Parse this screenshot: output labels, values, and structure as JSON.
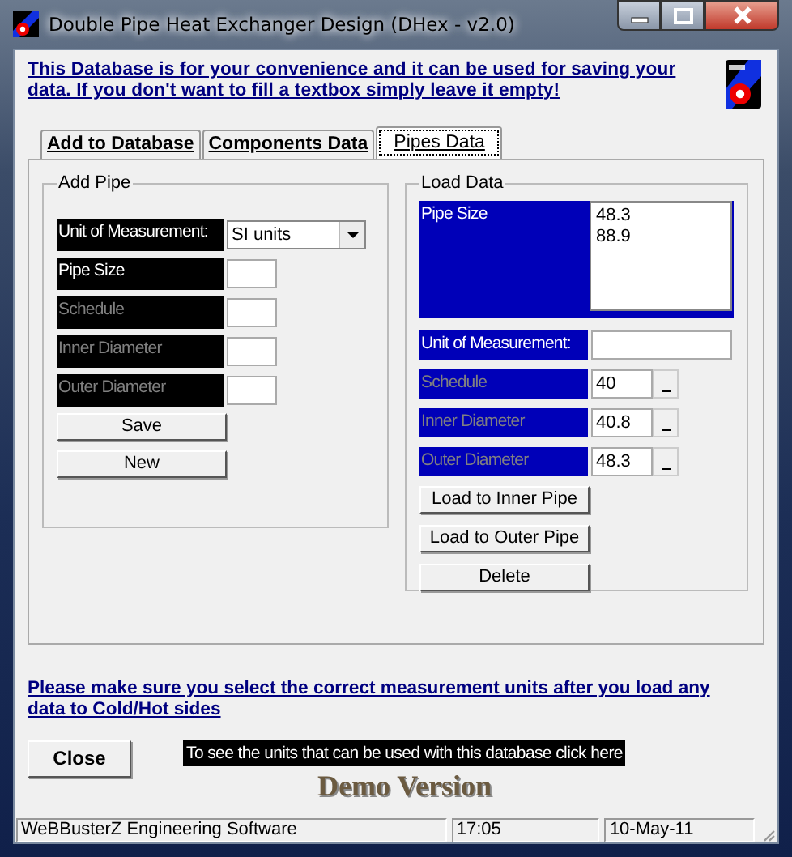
{
  "window": {
    "title": "Double Pipe Heat Exchanger Design (DHex - v2.0)"
  },
  "notice": "This Database is for your convenience and it can be used for saving your data. If you don't want to fill a textbox simply leave it empty!",
  "tabs": [
    {
      "label": "Add to Database",
      "selected": false
    },
    {
      "label": "Components Data",
      "selected": false
    },
    {
      "label": "Pipes Data",
      "selected": true
    }
  ],
  "add_pipe": {
    "title": "Add Pipe",
    "fields": [
      {
        "label": "Unit of Measurement:",
        "kind": "dropdown",
        "value": "SI units",
        "disabled": false
      },
      {
        "label": "Pipe Size",
        "kind": "text",
        "disabled": false
      },
      {
        "label": "Schedule",
        "kind": "text",
        "disabled": true
      },
      {
        "label": "Inner Diameter",
        "kind": "text",
        "disabled": true
      },
      {
        "label": "Outer Diameter",
        "kind": "text",
        "disabled": true
      }
    ],
    "buttons": [
      "Save",
      "New"
    ]
  },
  "load_data": {
    "title": "Load Data",
    "list_label": "Pipe Size",
    "list_items": [
      "48.3",
      "88.9"
    ],
    "fields": [
      {
        "label": "Unit of Measurement:",
        "kind": "text",
        "disabled": false
      },
      {
        "label": "Schedule",
        "kind": "spin",
        "value": "40",
        "disabled": true
      },
      {
        "label": "Inner Diameter",
        "kind": "spin",
        "value": "40.8",
        "disabled": true
      },
      {
        "label": "Outer Diameter",
        "kind": "spin",
        "value": "48.3",
        "disabled": true
      }
    ],
    "buttons": [
      "Load to Inner Pipe",
      "Load to Outer Pipe",
      "Delete"
    ]
  },
  "warning": "Please make sure you select the correct measurement units after you load any data to Cold/Hot sides",
  "close_button": "Close",
  "units_link": "To see the units that can be used with this database click here",
  "demo_label": "Demo Version",
  "status_bar": [
    "WeBBusterZ Engineering Software",
    "17:05",
    "10-May-11"
  ]
}
